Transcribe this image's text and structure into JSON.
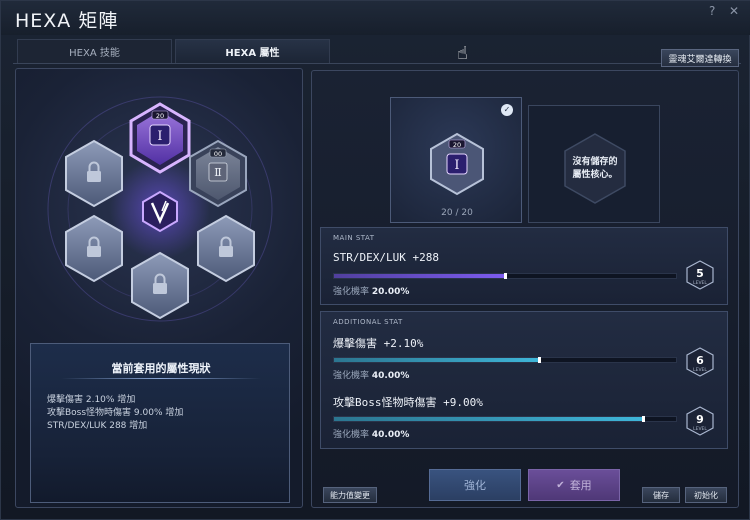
{
  "window": {
    "title": "HEXA 矩陣",
    "help_glyph": "?",
    "close_glyph": "✕"
  },
  "tabs": [
    {
      "label": "HEXA 技能",
      "active": false
    },
    {
      "label": "HEXA 屬性",
      "active": true
    }
  ],
  "convert_button": "靈魂艾爾達轉換",
  "hexgrid": {
    "top_level": "20",
    "right_level": "00",
    "center_icon": "hexa-v-emblem-icon",
    "locked_icon": "lock-icon"
  },
  "status": {
    "title": "當前套用的屬性現狀",
    "lines": [
      "爆擊傷害 2.10% 增加",
      "攻擊Boss怪物時傷害 9.00% 增加",
      "STR/DEX/LUK 288 增加"
    ]
  },
  "core": {
    "level_badge": "20",
    "count": "20 / 20"
  },
  "empty_core": {
    "line1": "沒有儲存的",
    "line2": "屬性核心。"
  },
  "main_stat": {
    "header": "MAIN STAT",
    "text": "STR/DEX/LUK +288",
    "rate_label": "強化機率",
    "rate_value": "20.00%",
    "level": "5",
    "level_word": "LEVEL",
    "progress": 0.5
  },
  "additional_stat": {
    "header": "ADDITIONAL STAT",
    "items": [
      {
        "text": "爆擊傷害 +2.10%",
        "rate_label": "強化機率",
        "rate_value": "40.00%",
        "level": "6",
        "level_word": "LEVEL",
        "progress": 0.6
      },
      {
        "text": "攻擊Boss怪物時傷害 +9.00%",
        "rate_label": "強化機率",
        "rate_value": "40.00%",
        "level": "9",
        "level_word": "LEVEL",
        "progress": 0.9
      }
    ]
  },
  "buttons": {
    "ability_change": "能力值變更",
    "enhance": "強化",
    "apply": "套用",
    "save": "儲存",
    "reset": "初始化"
  },
  "colors": {
    "main_fill": "#7d5cf0",
    "add_fill": "#3fb6d9",
    "frame": "#3c4760"
  }
}
